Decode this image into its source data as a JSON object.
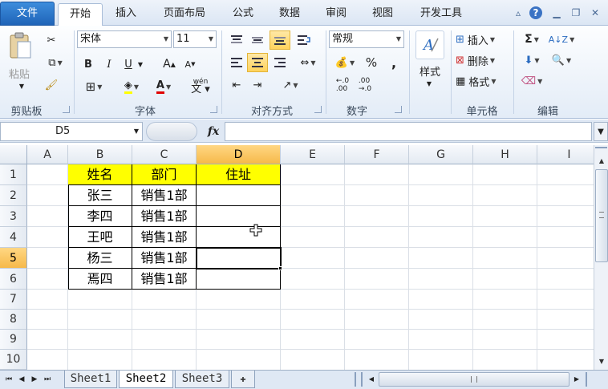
{
  "tabs": {
    "file": "文件",
    "home": "开始",
    "insert": "插入",
    "page_layout": "页面布局",
    "formulas": "公式",
    "data": "数据",
    "review": "审阅",
    "view": "视图",
    "developer": "开发工具"
  },
  "ribbon": {
    "clipboard": {
      "paste": "粘贴",
      "label": "剪贴板"
    },
    "font": {
      "name": "宋体",
      "size": "11",
      "bold": "B",
      "italic": "I",
      "underline": "U",
      "grow": "A",
      "shrink": "A",
      "font_color": "A",
      "wen": "wén",
      "label": "字体"
    },
    "alignment": {
      "label": "对齐方式"
    },
    "number": {
      "format": "常规",
      "percent": "%",
      "comma": ",",
      "label": "数字"
    },
    "styles": {
      "styles": "样式"
    },
    "cells": {
      "insert": "插入",
      "delete": "删除",
      "format": "格式",
      "label": "单元格"
    },
    "editing": {
      "sum": "Σ",
      "label": "编辑"
    }
  },
  "formula_bar": {
    "name_box": "D5",
    "fx": "fx",
    "content": ""
  },
  "grid": {
    "columns": [
      "A",
      "B",
      "C",
      "D",
      "E",
      "F",
      "G",
      "H",
      "I"
    ],
    "rows": [
      "1",
      "2",
      "3",
      "4",
      "5",
      "6",
      "7",
      "8",
      "9",
      "10"
    ],
    "selected_column": "D",
    "selected_row": "5",
    "table": {
      "headers": [
        "姓名",
        "部门",
        "住址"
      ],
      "rows": [
        [
          "张三",
          "销售1部",
          ""
        ],
        [
          "李四",
          "销售1部",
          ""
        ],
        [
          "王吧",
          "销售1部",
          ""
        ],
        [
          "杨三",
          "销售1部",
          ""
        ],
        [
          "焉四",
          "销售1部",
          ""
        ]
      ]
    }
  },
  "sheets": [
    "Sheet1",
    "Sheet2",
    "Sheet3"
  ],
  "active_sheet": "Sheet2",
  "colors": {
    "header_fill": "#ffff00",
    "file_tab": "#2a72c6",
    "selected_header": "#f6b94a"
  }
}
